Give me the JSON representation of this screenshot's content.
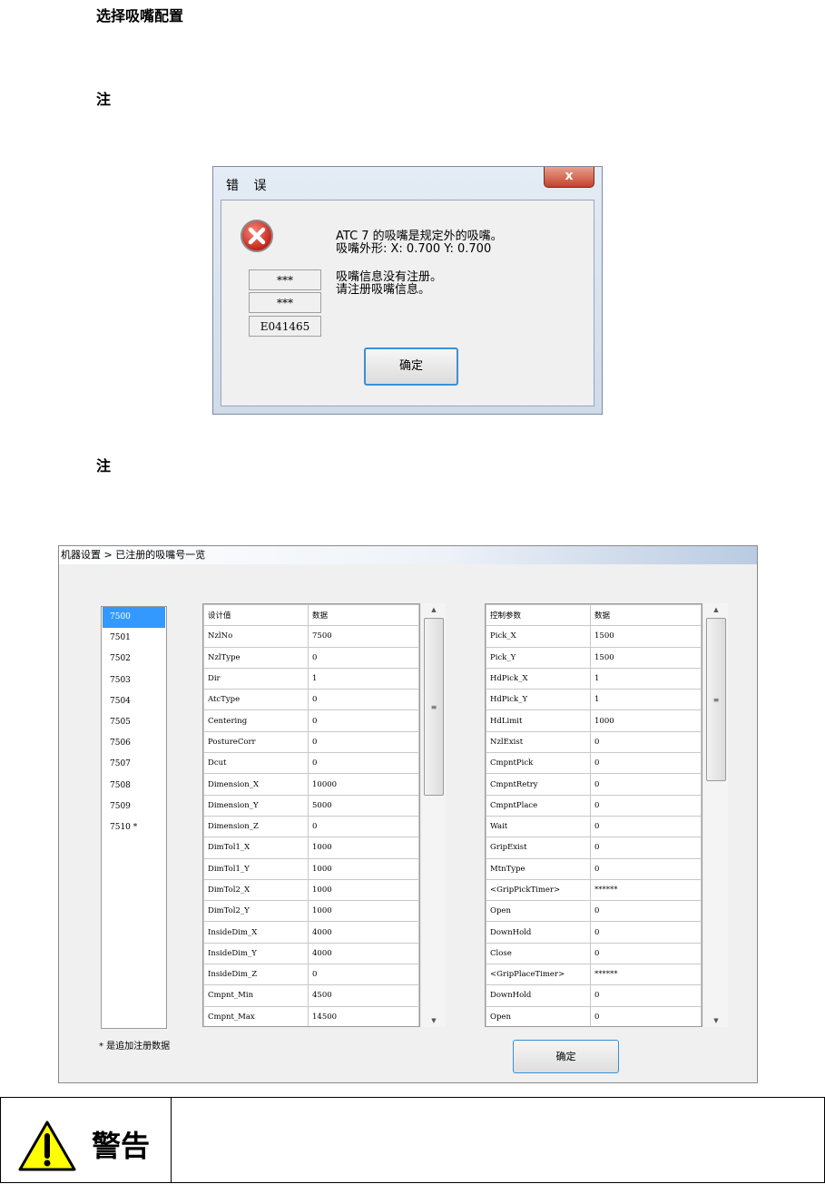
{
  "headings": {
    "select": "选择吸嘴配置",
    "note1": "注",
    "note2": "注"
  },
  "error_dialog": {
    "title": "错 误",
    "close_glyph": "x",
    "icon": "error-x-icon",
    "codes": [
      "***",
      "***",
      "E041465"
    ],
    "message_line1": "ATC 7 的吸嘴是规定外的吸嘴。",
    "message_line2": "吸嘴外形: X:  0.700 Y:  0.700",
    "message_line3": "吸嘴信息没有注册。",
    "message_line4": "请注册吸嘴信息。",
    "ok_label": "确定"
  },
  "settings_window": {
    "title": "机器设置 > 已注册的吸嘴号一览",
    "nozzle_list": [
      "7500",
      "7501",
      "7502",
      "7503",
      "7504",
      "7505",
      "7506",
      "7507",
      "7508",
      "7509",
      "7510 *"
    ],
    "selected_index": 0,
    "footnote": "* 是追加注册数据",
    "design_table": {
      "headers": [
        "设计值",
        "数据"
      ],
      "rows": [
        [
          "NzlNo",
          "7500"
        ],
        [
          "NzlType",
          "0"
        ],
        [
          "Dir",
          "1"
        ],
        [
          "AtcType",
          "0"
        ],
        [
          "Centering",
          "0"
        ],
        [
          "PostureCorr",
          "0"
        ],
        [
          "Dcut",
          "0"
        ],
        [
          "Dimension_X",
          "10000"
        ],
        [
          "Dimension_Y",
          "5000"
        ],
        [
          "Dimension_Z",
          "0"
        ],
        [
          "DimTol1_X",
          "1000"
        ],
        [
          "DimTol1_Y",
          "1000"
        ],
        [
          "DimTol2_X",
          "1000"
        ],
        [
          "DimTol2_Y",
          "1000"
        ],
        [
          "InsideDim_X",
          "4000"
        ],
        [
          "InsideDim_Y",
          "4000"
        ],
        [
          "InsideDim_Z",
          "0"
        ],
        [
          "Cmpnt_Min",
          "4500"
        ],
        [
          "Cmpnt_Max",
          "14500"
        ]
      ]
    },
    "control_table": {
      "headers": [
        "控制参数",
        "数据"
      ],
      "rows": [
        [
          "Pick_X",
          "1500"
        ],
        [
          "Pick_Y",
          "1500"
        ],
        [
          "HdPick_X",
          "1"
        ],
        [
          "HdPick_Y",
          "1"
        ],
        [
          "HdLimit",
          "1000"
        ],
        [
          "NzlExist",
          "0"
        ],
        [
          "CmpntPick",
          "0"
        ],
        [
          "CmpntRetry",
          "0"
        ],
        [
          "CmpntPlace",
          "0"
        ],
        [
          "Wait",
          "0"
        ],
        [
          "GripExist",
          "0"
        ],
        [
          "MtnType",
          "0"
        ],
        [
          "<GripPickTimer>",
          " ******"
        ],
        [
          "Open",
          "0"
        ],
        [
          "DownHold",
          "0"
        ],
        [
          "Close",
          "0"
        ],
        [
          "<GripPlaceTimer>",
          " ******"
        ],
        [
          "DownHold",
          "0"
        ],
        [
          "Open",
          "0"
        ]
      ]
    },
    "scroll_up": "▲",
    "scroll_down": "▼",
    "scroll_grip": "≡",
    "ok_label": "确定"
  },
  "warning": {
    "label": "警告",
    "icon": "warning-triangle-icon",
    "text": ""
  }
}
